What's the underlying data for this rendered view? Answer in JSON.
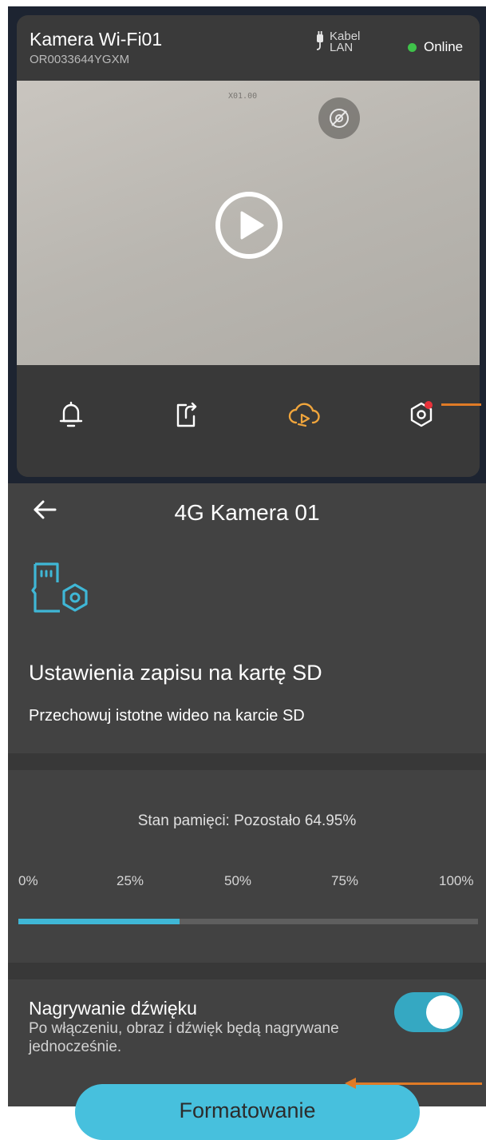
{
  "camera": {
    "title": "Kamera Wi-Fi01",
    "serial": "OR0033644YGXM",
    "connection_line1": "Kabel",
    "connection_line2": "LAN",
    "status": "Online",
    "zoom_label": "X01.00",
    "status_color": "#3fc24a",
    "toolbar": [
      "bell-icon",
      "share-icon",
      "cloud-playback-icon",
      "settings-icon"
    ],
    "toolbar_accent_color": "#f0a53c"
  },
  "settings": {
    "page_title": "4G Kamera 01",
    "section_title": "Ustawienia zapisu na kartę SD",
    "section_desc": "Przechowuj istotne wideo na karcie SD",
    "storage_status": "Stan pamięci: Pozostało 64.95%",
    "scale": [
      "0%",
      "25%",
      "50%",
      "75%",
      "100%"
    ],
    "used_fraction": 0.35,
    "audio_title": "Nagrywanie dźwięku",
    "audio_desc": "Po włączeniu, obraz i dźwięk będą nagrywane jednocześnie.",
    "audio_enabled": true,
    "format_button": "Formatowanie",
    "accent_color": "#47c0dd",
    "annotation_color": "#e07b26"
  }
}
